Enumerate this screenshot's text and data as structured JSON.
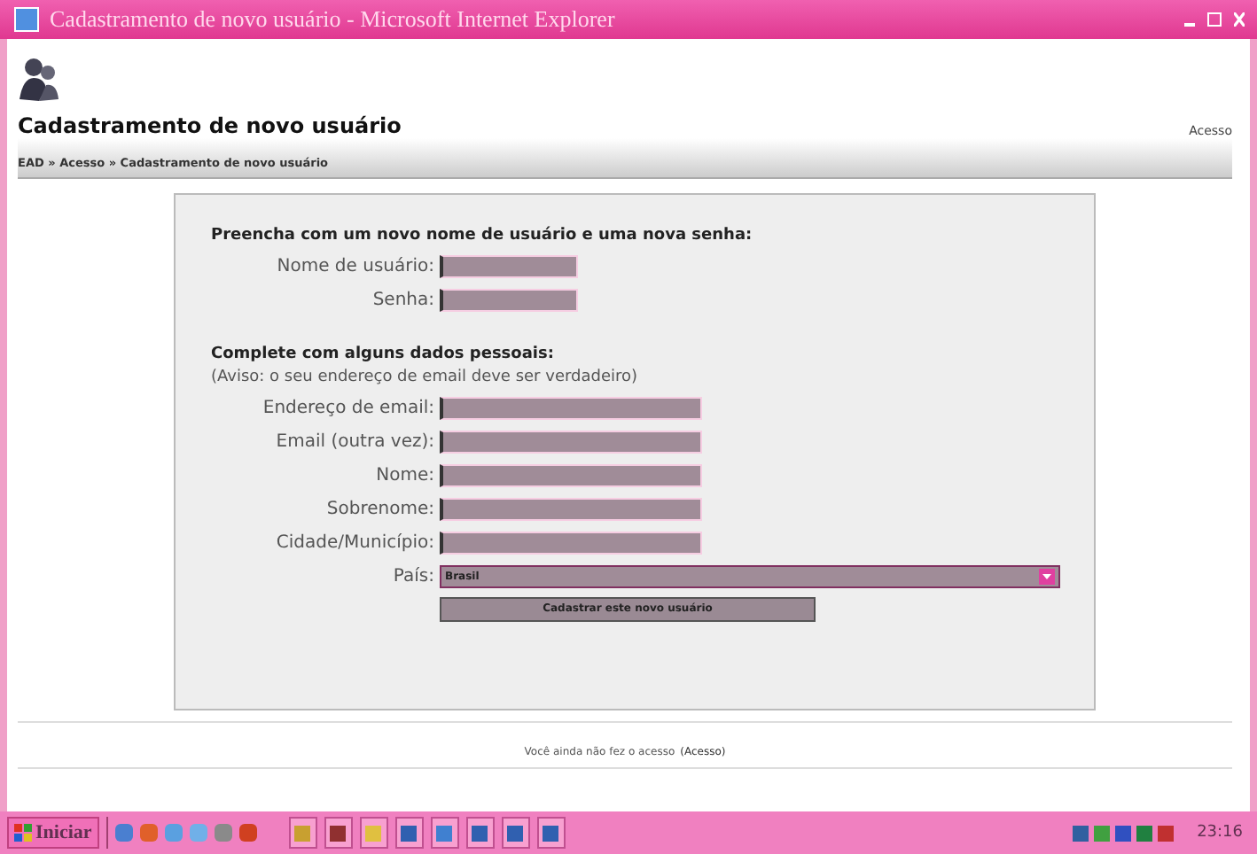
{
  "window": {
    "title": "Cadastramento de novo usuário - Microsoft Internet Explorer"
  },
  "header": {
    "title": "Cadastramento de novo usuário",
    "login_link": "Acesso",
    "breadcrumb": "EAD » Acesso » Cadastramento de novo usuário"
  },
  "form": {
    "sections": [
      {
        "heading": "Preencha com um novo nome de usuário e uma nova senha:",
        "fields": [
          {
            "label": "Nome de usuário:",
            "kind": "short"
          },
          {
            "label": "Senha:",
            "kind": "short"
          }
        ]
      },
      {
        "heading": "Complete com alguns dados pessoais:",
        "note": "(Aviso: o seu endereço de email deve ser verdadeiro)",
        "fields": [
          {
            "label": "Endereço de email:",
            "kind": "long"
          },
          {
            "label": "Email (outra vez):",
            "kind": "long"
          },
          {
            "label": "Nome:",
            "kind": "long"
          },
          {
            "label": "Sobrenome:",
            "kind": "long"
          },
          {
            "label": "Cidade/Município:",
            "kind": "long"
          },
          {
            "label": "País:",
            "kind": "select",
            "value": "Brasil"
          }
        ]
      }
    ],
    "submit": "Cadastrar este novo usuário"
  },
  "footer": {
    "text": "Você ainda não fez o acesso",
    "link": "(Acesso)"
  },
  "taskbar": {
    "start": "Iniciar",
    "clock": "23:16"
  }
}
